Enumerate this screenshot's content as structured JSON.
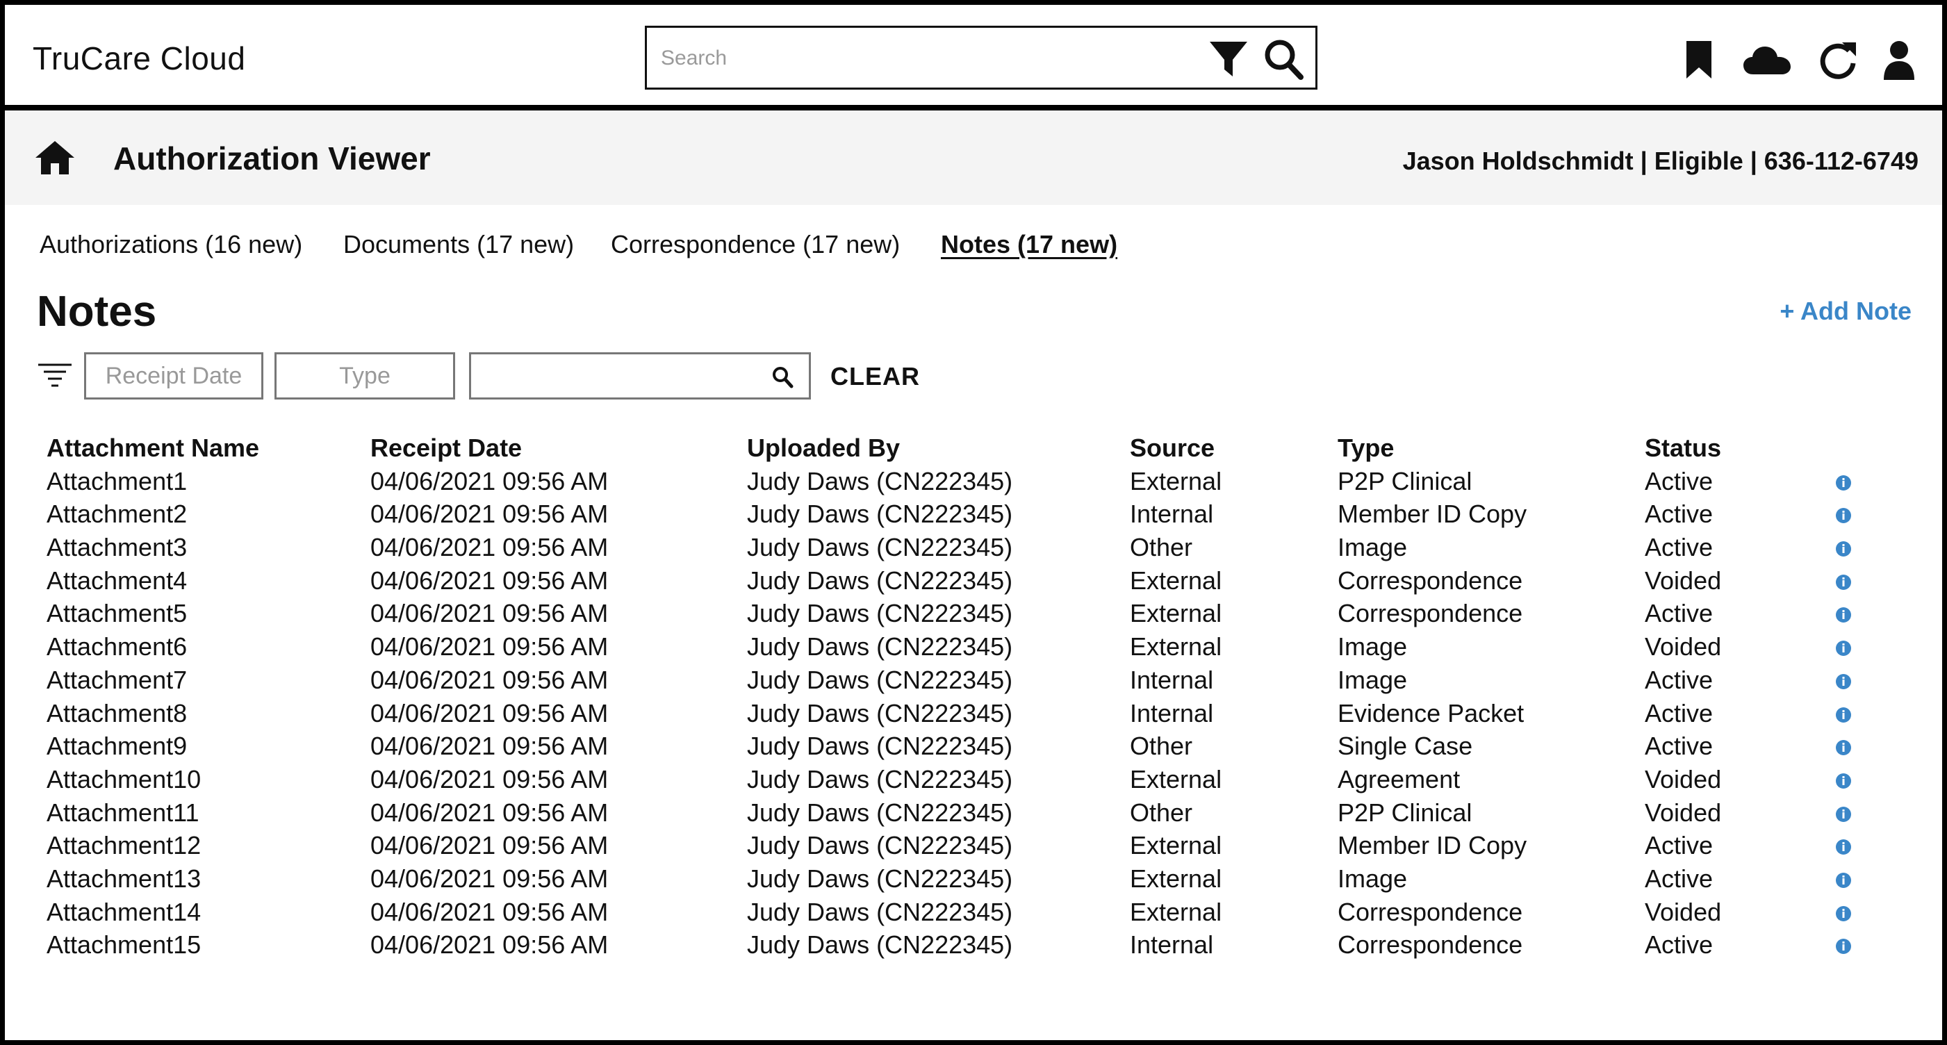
{
  "app": {
    "title": "TruCare Cloud"
  },
  "search": {
    "placeholder": "Search"
  },
  "icons": [
    "filter-icon",
    "search-icon",
    "bookmark-icon",
    "cloud-icon",
    "refresh-icon",
    "user-icon",
    "home-icon",
    "info-icon"
  ],
  "header": {
    "page_title": "Authorization Viewer",
    "member_info": "Jason Holdschmidt | Eligible | 636-112-6749"
  },
  "tabs": [
    {
      "label": "Authorizations (16 new)",
      "active": false
    },
    {
      "label": "Documents (17 new)",
      "active": false
    },
    {
      "label": "Correspondence (17 new)",
      "active": false
    },
    {
      "label": "Notes (17 new)",
      "active": true
    }
  ],
  "section": {
    "title": "Notes",
    "add_label": "+ Add Note"
  },
  "filters": {
    "receipt_date_placeholder": "Receipt Date",
    "type_placeholder": "Type",
    "search_value": "",
    "clear_label": "CLEAR"
  },
  "table": {
    "columns": [
      "Attachment Name",
      "Receipt Date",
      "Uploaded By",
      "Source",
      "Type",
      "Status"
    ],
    "rows": [
      [
        "Attachment1",
        "04/06/2021 09:56 AM",
        "Judy Daws (CN222345)",
        "External",
        "P2P Clinical",
        "Active"
      ],
      [
        "Attachment2",
        "04/06/2021 09:56 AM",
        "Judy Daws (CN222345)",
        "Internal",
        "Member ID Copy",
        "Active"
      ],
      [
        "Attachment3",
        "04/06/2021 09:56 AM",
        "Judy Daws (CN222345)",
        "Other",
        "Image",
        "Active"
      ],
      [
        "Attachment4",
        "04/06/2021 09:56 AM",
        "Judy Daws (CN222345)",
        "External",
        "Correspondence",
        "Voided"
      ],
      [
        "Attachment5",
        "04/06/2021 09:56 AM",
        "Judy Daws (CN222345)",
        "External",
        "Correspondence",
        "Active"
      ],
      [
        "Attachment6",
        "04/06/2021 09:56 AM",
        "Judy Daws (CN222345)",
        "External",
        "Image",
        "Voided"
      ],
      [
        "Attachment7",
        "04/06/2021 09:56 AM",
        "Judy Daws (CN222345)",
        "Internal",
        "Image",
        "Active"
      ],
      [
        "Attachment8",
        "04/06/2021 09:56 AM",
        "Judy Daws (CN222345)",
        "Internal",
        "Evidence Packet",
        "Active"
      ],
      [
        "Attachment9",
        "04/06/2021 09:56 AM",
        "Judy Daws (CN222345)",
        "Other",
        "Single Case",
        "Active"
      ],
      [
        "Attachment10",
        "04/06/2021 09:56 AM",
        "Judy Daws (CN222345)",
        "External",
        "Agreement",
        "Voided"
      ],
      [
        "Attachment11",
        "04/06/2021 09:56 AM",
        "Judy Daws (CN222345)",
        "Other",
        "P2P Clinical",
        "Voided"
      ],
      [
        "Attachment12",
        "04/06/2021 09:56 AM",
        "Judy Daws (CN222345)",
        "External",
        "Member ID Copy",
        "Active"
      ],
      [
        "Attachment13",
        "04/06/2021 09:56 AM",
        "Judy Daws (CN222345)",
        "External",
        "Image",
        "Active"
      ],
      [
        "Attachment14",
        "04/06/2021 09:56 AM",
        "Judy Daws (CN222345)",
        "External",
        "Correspondence",
        "Voided"
      ],
      [
        "Attachment15",
        "04/06/2021 09:56 AM",
        "Judy Daws (CN222345)",
        "Internal",
        "Correspondence",
        "Active"
      ]
    ]
  },
  "colors": {
    "accent": "#3a86c8",
    "text": "#111111",
    "header_band": "#f4f4f4"
  }
}
